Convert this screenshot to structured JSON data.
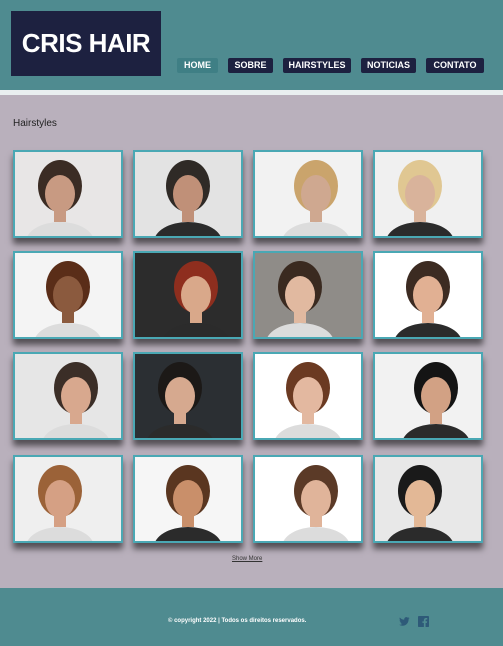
{
  "brand": {
    "logo_text": "CRIS HAIR"
  },
  "nav": [
    {
      "label": "HOME",
      "active": true
    },
    {
      "label": "SOBRE",
      "active": false
    },
    {
      "label": "HAIRSTYLES",
      "active": false
    },
    {
      "label": "NOTICIAS",
      "active": false
    },
    {
      "label": "CONTATO",
      "active": false
    }
  ],
  "section": {
    "title": "Hairstyles"
  },
  "gallery": {
    "images": [
      "haircut-clipper-photo",
      "haircut-side-photo",
      "blonde-hair-cut-photo",
      "blow-dry-photo",
      "curly-hair-woman-photo",
      "red-bob-profile-photo",
      "woman-suit-portrait-photo",
      "smiling-young-man-photo",
      "doctor-portrait-photo",
      "glasses-man-chalkboard-photo",
      "long-brown-hair-woman-photo",
      "asymmetric-hair-man-photo",
      "wavy-hair-necklace-woman-photo",
      "curly-brunette-smile-photo",
      "man-turtleneck-photo",
      "man-suit-smile-photo"
    ],
    "show_more_label": "Show More"
  },
  "footer": {
    "copyright": "© copyright 2022 | Todos os direitos reservados.",
    "social_icons": [
      "twitter-icon",
      "facebook-icon"
    ]
  },
  "colors": {
    "header_bg": "#4f8b90",
    "logo_bg": "#1d2140",
    "nav_active": "#3f7f85",
    "page_bg": "#b9b0bc",
    "tile_border": "#4aa8b4"
  }
}
